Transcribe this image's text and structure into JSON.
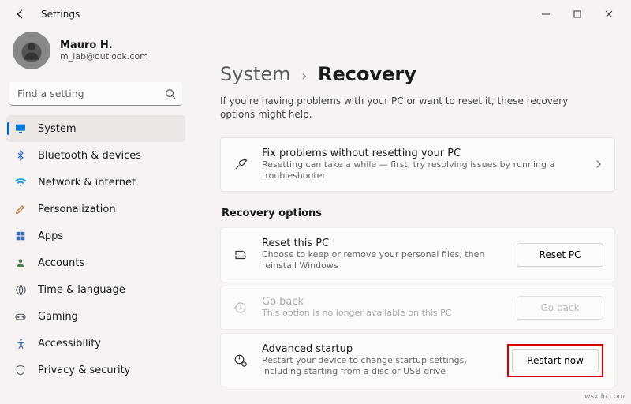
{
  "window": {
    "title": "Settings"
  },
  "profile": {
    "name": "Mauro H.",
    "email": "m_lab@outlook.com"
  },
  "search": {
    "placeholder": "Find a setting"
  },
  "sidebar": {
    "items": [
      {
        "label": "System",
        "icon": "monitor",
        "color": "#0078d4",
        "selected": true
      },
      {
        "label": "Bluetooth & devices",
        "icon": "bluetooth",
        "color": "#2a62c9"
      },
      {
        "label": "Network & internet",
        "icon": "wifi",
        "color": "#16a0d8"
      },
      {
        "label": "Personalization",
        "icon": "brush",
        "color": "#c97a3f"
      },
      {
        "label": "Apps",
        "icon": "grid",
        "color": "#3a6bb8"
      },
      {
        "label": "Accounts",
        "icon": "person",
        "color": "#4a7a55"
      },
      {
        "label": "Time & language",
        "icon": "globe",
        "color": "#454a52"
      },
      {
        "label": "Gaming",
        "icon": "gamepad",
        "color": "#5a5e66"
      },
      {
        "label": "Accessibility",
        "icon": "accessibility",
        "color": "#3e67a8"
      },
      {
        "label": "Privacy & security",
        "icon": "shield",
        "color": "#5a5e66"
      }
    ]
  },
  "breadcrumb": {
    "parent": "System",
    "chevron": "›",
    "current": "Recovery"
  },
  "intro": "If you're having problems with your PC or want to reset it, these recovery options might help.",
  "troubleshoot_card": {
    "title": "Fix problems without resetting your PC",
    "desc": "Resetting can take a while — first, try resolving issues by running a troubleshooter"
  },
  "section_label": "Recovery options",
  "reset_card": {
    "title": "Reset this PC",
    "desc": "Choose to keep or remove your personal files, then reinstall Windows",
    "button": "Reset PC"
  },
  "goback_card": {
    "title": "Go back",
    "desc": "This option is no longer available on this PC",
    "button": "Go back"
  },
  "adv_card": {
    "title": "Advanced startup",
    "desc": "Restart your device to change startup settings, including starting from a disc or USB drive",
    "button": "Restart now"
  },
  "attribution": "wsxdn.com"
}
